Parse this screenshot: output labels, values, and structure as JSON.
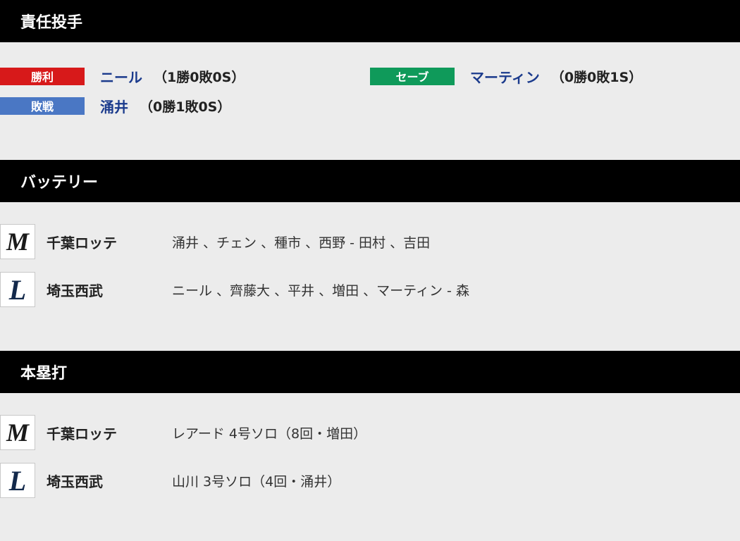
{
  "sections": {
    "responsible": {
      "title": "責任投手",
      "win": {
        "badge": "勝利",
        "name": "ニール",
        "record": "（1勝0敗0S）"
      },
      "lose": {
        "badge": "敗戦",
        "name": "涌井",
        "record": "（0勝1敗0S）"
      },
      "save": {
        "badge": "セーブ",
        "name": "マーティン",
        "record": "（0勝0敗1S）"
      }
    },
    "battery": {
      "title": "バッテリー",
      "rows": [
        {
          "team": "千葉ロッテ",
          "detail": "涌井 、チェン 、種市 、西野 - 田村 、吉田"
        },
        {
          "team": "埼玉西武",
          "detail": "ニール 、齊藤大 、平井 、増田 、マーティン - 森"
        }
      ]
    },
    "homeruns": {
      "title": "本塁打",
      "rows": [
        {
          "team": "千葉ロッテ",
          "detail": "レアード 4号ソロ（8回・増田）"
        },
        {
          "team": "埼玉西武",
          "detail": "山川 3号ソロ（4回・涌井）"
        }
      ]
    }
  },
  "colors": {
    "win": "#d7191a",
    "lose": "#4a77c4",
    "save": "#0f9a5a",
    "player_link": "#1a3a8c"
  },
  "icons": {
    "lotte": "marines-m-logo-icon",
    "seibu": "lions-l-logo-icon"
  }
}
